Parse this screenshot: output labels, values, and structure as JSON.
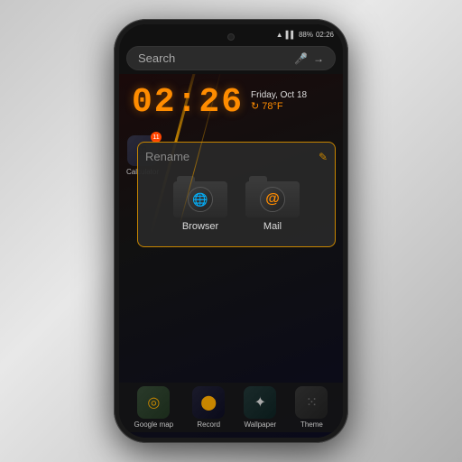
{
  "phone": {
    "status_bar": {
      "signal": "▌▌▌▌",
      "battery": "88%",
      "time": "02:26"
    },
    "search": {
      "placeholder": "Search",
      "mic_icon": "mic",
      "arrow_icon": "→"
    },
    "clock": {
      "time": "02:26",
      "date": "Friday, Oct 18",
      "temp": "78°F",
      "weather_icon": "↻"
    },
    "folder": {
      "rename_label": "Rename",
      "edit_icon": "✎",
      "apps": [
        {
          "name": "Browser",
          "icon": "🌐"
        },
        {
          "name": "Mail",
          "icon": "@"
        }
      ]
    },
    "calc": {
      "label": "Calculator",
      "icon": "⊞",
      "notification": "11"
    },
    "dock": [
      {
        "label": "Google map",
        "icon": "◎",
        "type": "map"
      },
      {
        "label": "Record",
        "icon": "⬤",
        "type": "record"
      },
      {
        "label": "Wallpaper",
        "icon": "✦",
        "type": "wallpaper"
      },
      {
        "label": "Theme",
        "icon": "⁙",
        "type": "theme"
      }
    ]
  }
}
